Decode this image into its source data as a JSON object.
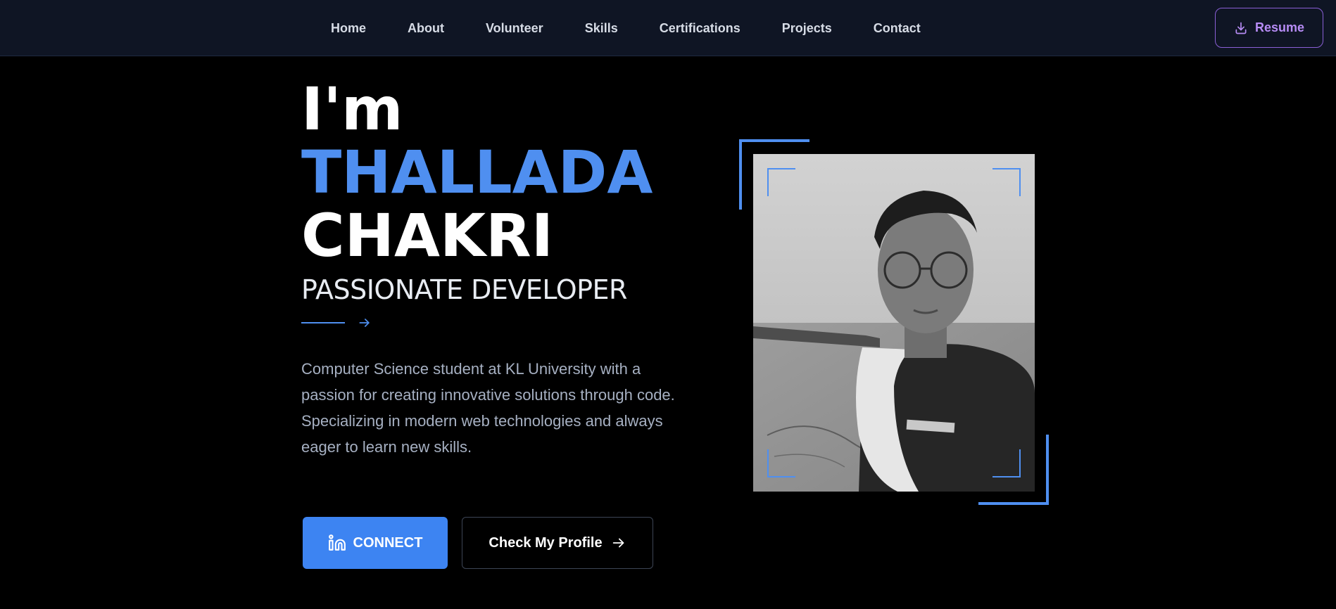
{
  "nav": {
    "links": [
      "Home",
      "About",
      "Volunteer",
      "Skills",
      "Certifications",
      "Projects",
      "Contact"
    ],
    "resume_label": "Resume"
  },
  "hero": {
    "greeting": "I'm",
    "first_name": "THALLADA",
    "last_name": "CHAKRI",
    "role": "PASSIONATE DEVELOPER",
    "bio": "Computer Science student at KL University with a passion for creating innovative solutions through code. Specializing in modern web technologies and always eager to learn new skills.",
    "connect_label": "CONNECT",
    "profile_label": "Check My Profile"
  },
  "colors": {
    "accent_blue": "#4f8ff0",
    "button_blue": "#3d84f2",
    "resume_purple": "#b78cf5",
    "nav_bg": "#0f1524",
    "page_bg": "#000000"
  },
  "icons": {
    "resume": "download-icon",
    "connect": "linkedin-icon",
    "profile": "arrow-right-icon",
    "accent": "arrow-right-icon"
  }
}
